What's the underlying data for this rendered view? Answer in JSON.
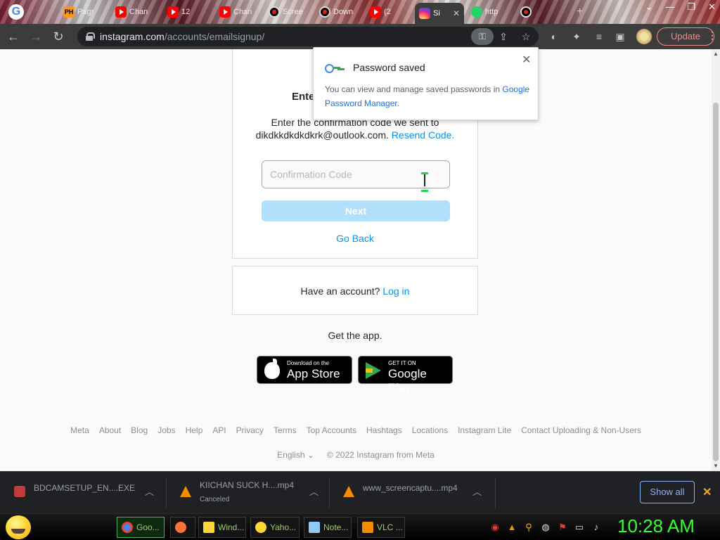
{
  "browser": {
    "tabs": [
      {
        "label": "Pagr",
        "icon": "ph"
      },
      {
        "label": "Chan",
        "icon": "yt"
      },
      {
        "label": "12",
        "icon": "yt"
      },
      {
        "label": "Chan",
        "icon": "yt"
      },
      {
        "label": "Scree",
        "icon": "rec"
      },
      {
        "label": "Down",
        "icon": "rec"
      },
      {
        "label": "(2",
        "icon": "yt"
      },
      {
        "label": "Si",
        "icon": "ig"
      },
      {
        "label": "http",
        "icon": "wa"
      },
      {
        "label": "",
        "icon": "rec"
      }
    ],
    "url_host": "instagram.com",
    "url_path": "/accounts/emailsignup/",
    "update_label": "Update"
  },
  "page": {
    "heading": "Ente",
    "instruction_line1": "Enter the confirmation code we sent to",
    "instruction_email": "dikdkkdkdkdkrk@outlook.com.",
    "resend_label": "Resend Code.",
    "code_placeholder": "Confirmation Code",
    "next_label": "Next",
    "go_back_label": "Go Back",
    "have_account": "Have an account?",
    "login_label": "Log in",
    "get_app": "Get the app.",
    "appstore_small": "Download on the",
    "appstore_big": "App Store",
    "googleplay_small": "GET IT ON",
    "googleplay_big": "Google Play",
    "footer_links": [
      "Meta",
      "About",
      "Blog",
      "Jobs",
      "Help",
      "API",
      "Privacy",
      "Terms",
      "Top Accounts",
      "Hashtags",
      "Locations",
      "Instagram Lite",
      "Contact Uploading & Non-Users"
    ],
    "language": "English",
    "copyright": "© 2022 Instagram from Meta"
  },
  "password_popup": {
    "title": "Password saved",
    "body_prefix": "You can view and manage saved passwords in",
    "body_link_1": "Google",
    "body_link_2": "Password Manager",
    "body_suffix": "."
  },
  "downloads": {
    "items": [
      {
        "name": "BDCAMSETUP_EN....EXE",
        "status": "",
        "icon": "bdcam"
      },
      {
        "name": "KIICHAN SUCK H....mp4",
        "status": "Canceled",
        "icon": "vlc"
      },
      {
        "name": "www_screencaptu....mp4",
        "status": "",
        "icon": "vlc"
      }
    ],
    "show_all_label": "Show all"
  },
  "taskbar": {
    "buttons": [
      {
        "label": "Goo...",
        "active": true,
        "color": "#4285f4"
      },
      {
        "label": "",
        "active": false,
        "color": "#ff7139"
      },
      {
        "label": "Wind...",
        "active": false,
        "color": "#fdd835"
      },
      {
        "label": "Yaho...",
        "active": false,
        "color": "#fdd835"
      },
      {
        "label": "Note...",
        "active": false,
        "color": "#90caf9"
      },
      {
        "label": "VLC ...",
        "active": false,
        "color": "#f28c00"
      }
    ],
    "clock": "10:28 AM"
  },
  "colors": {
    "accent_blue": "#0095f6",
    "next_disabled": "#b2dffc",
    "clock_green": "#33ff33"
  }
}
